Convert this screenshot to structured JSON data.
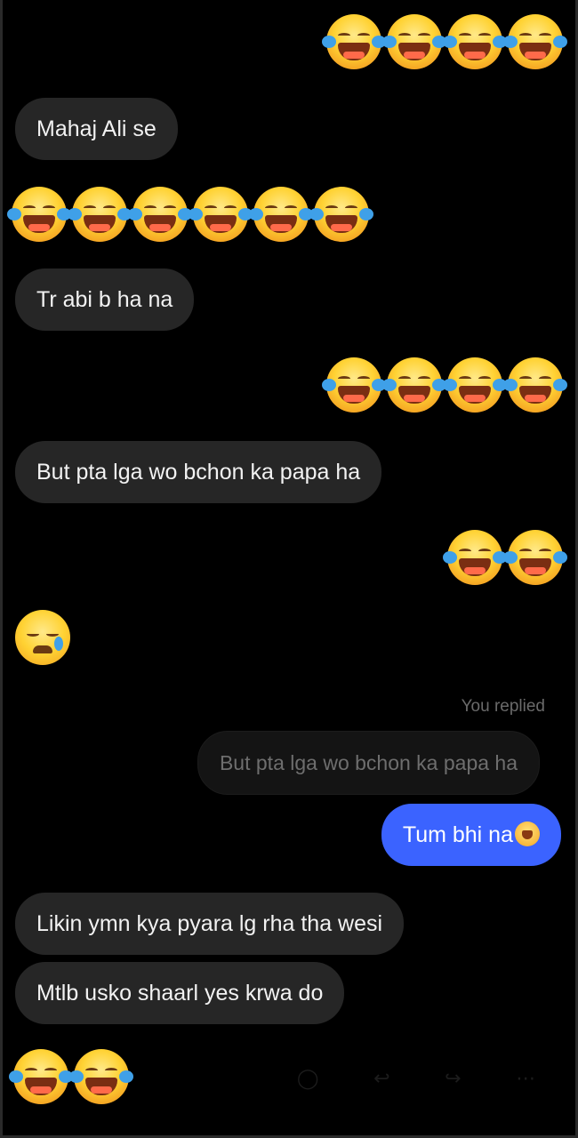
{
  "messages": [
    {
      "type": "emoji",
      "side": "right",
      "count": 4,
      "icon": "face-with-tears-of-joy"
    },
    {
      "type": "text",
      "side": "left",
      "text": "Mahaj Ali se"
    },
    {
      "type": "emoji",
      "side": "left",
      "count": 6,
      "icon": "face-with-tears-of-joy"
    },
    {
      "type": "text",
      "side": "left",
      "text": "Tr abi b ha na"
    },
    {
      "type": "emoji",
      "side": "right",
      "count": 4,
      "icon": "face-with-tears-of-joy"
    },
    {
      "type": "text",
      "side": "left",
      "text": "But pta lga wo bchon ka papa ha"
    },
    {
      "type": "emoji",
      "side": "right",
      "count": 2,
      "icon": "face-with-tears-of-joy"
    },
    {
      "type": "emoji",
      "side": "left",
      "count": 1,
      "icon": "crying-face"
    },
    {
      "type": "reply_label",
      "text": "You replied"
    },
    {
      "type": "quoted",
      "side": "right",
      "text": "But pta lga wo bchon ka papa ha"
    },
    {
      "type": "text",
      "side": "right",
      "text": "Tum bhi na",
      "color": "#3b63ff"
    },
    {
      "type": "text",
      "side": "left",
      "text": "Likin ymn kya pyara lg rha tha wesi"
    },
    {
      "type": "text",
      "side": "left",
      "text": "Mtlb usko shaarl yes krwa do"
    },
    {
      "type": "emoji",
      "side": "left",
      "count": 2,
      "icon": "face-with-tears-of-joy"
    }
  ],
  "colors": {
    "background": "#000000",
    "incoming_bubble": "#262626",
    "outgoing_bubble": "#3b63ff"
  }
}
